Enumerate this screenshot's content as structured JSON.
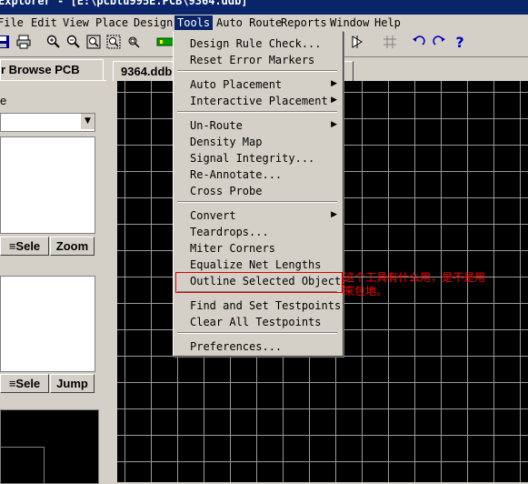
{
  "window": {
    "title": "Explorer - [E:\\pcbtu995E.PCB\\9364.ddb]"
  },
  "menubar": [
    {
      "label": "File",
      "active": false
    },
    {
      "label": "Edit",
      "active": false
    },
    {
      "label": "View",
      "active": false
    },
    {
      "label": "Place",
      "active": false
    },
    {
      "label": "Design",
      "active": false
    },
    {
      "label": "Tools",
      "active": true
    },
    {
      "label": "Auto Route",
      "active": false
    },
    {
      "label": "Reports",
      "active": false
    },
    {
      "label": "Window",
      "active": false
    },
    {
      "label": "Help",
      "active": false
    }
  ],
  "toolbar": {
    "left_icons": [
      "save-icon",
      "print-icon",
      "zoom-in-icon",
      "zoom-out-icon",
      "zoom-fit-icon",
      "zoom-select-icon",
      "zoom-area-icon",
      "component-icon"
    ],
    "right_icons": [
      "cross-probe-icon",
      "grid-icon",
      "undo-icon",
      "redo-icon",
      "help-icon"
    ],
    "help_glyph": "?"
  },
  "left_panel": {
    "tab_label": "r  Browse PCB",
    "section_label": "e",
    "select_button": "Sele",
    "zoom_button": "Zoom",
    "select_button2": "Sele",
    "jump_button": "Jump"
  },
  "document_tab": {
    "label": "9364.ddb"
  },
  "tools_menu": {
    "items": [
      {
        "label": "Design Rule Check...",
        "submenu": false
      },
      {
        "label": "Reset Error Markers",
        "submenu": false
      },
      {
        "label": "Auto Placement",
        "submenu": true
      },
      {
        "label": "Interactive Placement",
        "submenu": true
      },
      {
        "label": "Un-Route",
        "submenu": true
      },
      {
        "label": "Density Map",
        "submenu": false
      },
      {
        "label": "Signal Integrity...",
        "submenu": false
      },
      {
        "label": "Re-Annotate...",
        "submenu": false
      },
      {
        "label": "Cross Probe",
        "submenu": false
      },
      {
        "label": "Convert",
        "submenu": true
      },
      {
        "label": "Teardrops...",
        "submenu": true
      },
      {
        "label": "Miter Corners",
        "submenu": false
      },
      {
        "label": "Equalize Net Lengths",
        "submenu": false
      },
      {
        "label": "Outline Selected Objects",
        "submenu": false
      },
      {
        "label": "Find and Set Testpoints",
        "submenu": false
      },
      {
        "label": "Clear All Testpoints",
        "submenu": false
      },
      {
        "label": "Preferences...",
        "submenu": false
      }
    ]
  },
  "annotation": {
    "text_line1": "这个工具有什么用，是不是用",
    "text_line2": "来包地。",
    "color": "#ff0000"
  }
}
